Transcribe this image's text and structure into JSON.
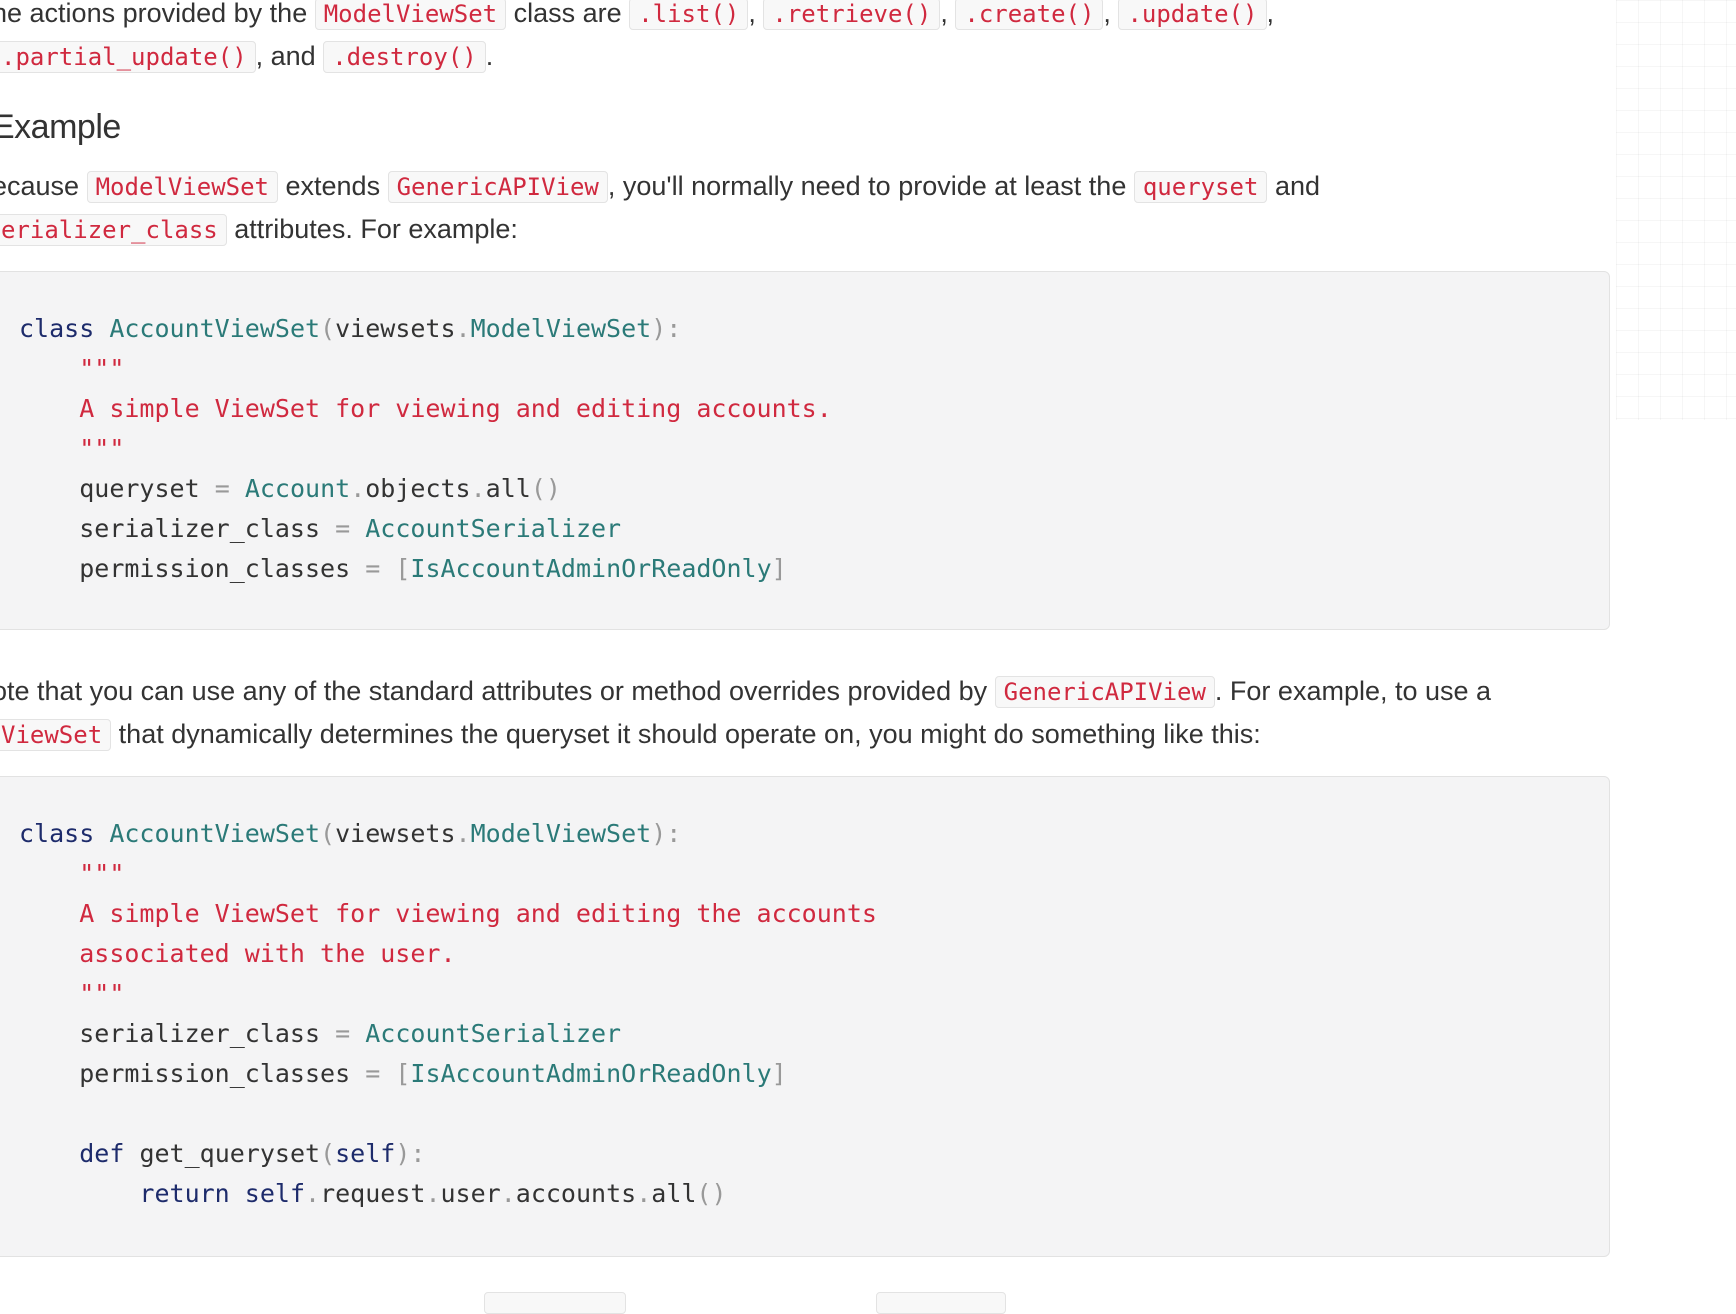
{
  "paragraph_actions": {
    "text_1": "he actions provided by the",
    "code_modelviewset": "ModelViewSet",
    "text_2": "class are",
    "code_list": ".list()",
    "sep_1": ",",
    "code_retrieve": ".retrieve()",
    "sep_2": ",",
    "code_create": ".create()",
    "sep_3": ",",
    "code_update": ".update()",
    "sep_4": ",",
    "code_partial_update": ".partial_update()",
    "text_and": ", and",
    "code_destroy": ".destroy()",
    "text_end": "."
  },
  "heading_example": "Example",
  "paragraph_because": {
    "text_1": "ecause",
    "code_modelviewset": "ModelViewSet",
    "text_2": "extends",
    "code_genericapiview": "GenericAPIView",
    "text_3": ", you'll normally need to provide at least the",
    "code_queryset": "queryset",
    "text_4": "and",
    "code_serializer_class": "erializer_class",
    "text_5": "attributes. For example:"
  },
  "code_block_1": {
    "l1_kw": "class",
    "l1_cls": "AccountViewSet",
    "l1_p1": "(",
    "l1_name": "viewsets",
    "l1_dot": ".",
    "l1_cls2": "ModelViewSet",
    "l1_p2": "):",
    "l2_str": "\"\"\"",
    "l3_str": "A simple ViewSet for viewing and editing accounts.",
    "l4_str": "\"\"\"",
    "l5_name": "queryset",
    "l5_op": "=",
    "l5_cls": "Account",
    "l5_dot1": ".",
    "l5_objects": "objects",
    "l5_dot2": ".",
    "l5_all": "all",
    "l5_parens": "()",
    "l6_name": "serializer_class",
    "l6_op": "=",
    "l6_cls": "AccountSerializer",
    "l7_name": "permission_classes",
    "l7_op": "=",
    "l7_b1": "[",
    "l7_cls": "IsAccountAdminOrReadOnly",
    "l7_b2": "]"
  },
  "paragraph_note": {
    "text_1": "ote that you can use any of the standard attributes or method overrides provided by",
    "code_genericapiview": "GenericAPIView",
    "text_2": ". For example, to use a",
    "code_viewset": "ViewSet",
    "text_3": "that dynamically determines the queryset it should operate on, you might do something like this:"
  },
  "code_block_2": {
    "l1_kw": "class",
    "l1_cls": "AccountViewSet",
    "l1_p1": "(",
    "l1_name": "viewsets",
    "l1_dot": ".",
    "l1_cls2": "ModelViewSet",
    "l1_p2": "):",
    "l2_str": "\"\"\"",
    "l3_str": "A simple ViewSet for viewing and editing the accounts",
    "l4_str": "associated with the user.",
    "l5_str": "\"\"\"",
    "l6_name": "serializer_class",
    "l6_op": "=",
    "l6_cls": "AccountSerializer",
    "l7_name": "permission_classes",
    "l7_op": "=",
    "l7_b1": "[",
    "l7_cls": "IsAccountAdminOrReadOnly",
    "l7_b2": "]",
    "l9_kw": "def",
    "l9_fn": "get_queryset",
    "l9_p1": "(",
    "l9_self": "self",
    "l9_p2": "):",
    "l10_kw": "return",
    "l10_self": "self",
    "l10_d1": ".",
    "l10_request": "request",
    "l10_d2": ".",
    "l10_user": "user",
    "l10_d3": ".",
    "l10_accounts": "accounts",
    "l10_d4": ".",
    "l10_all": "all",
    "l10_parens": "()"
  }
}
